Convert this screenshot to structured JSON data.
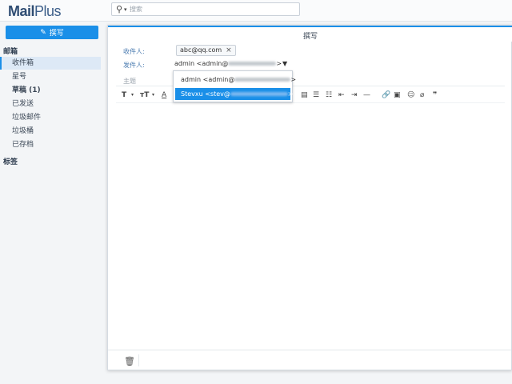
{
  "app": {
    "logo_main": "Mail",
    "logo_plus": "Plus"
  },
  "search": {
    "placeholder": "搜索",
    "search_glyph": "⚲",
    "caret": "▾"
  },
  "sidebar": {
    "compose_label": "撰写",
    "mailbox_title": "邮箱",
    "items": [
      {
        "label": "收件箱"
      },
      {
        "label": "星号"
      },
      {
        "label": "草稿 (1)"
      },
      {
        "label": "已发送"
      },
      {
        "label": "垃圾邮件"
      },
      {
        "label": "垃圾桶"
      },
      {
        "label": "已存档"
      }
    ],
    "labels_title": "标签"
  },
  "compose": {
    "window_title": "撰写",
    "to_label": "收件人:",
    "to_chip": "abc@qq.com",
    "from_label": "发件人:",
    "from_value_prefix": "admin <admin@",
    "from_value_suffix": ">",
    "subject_label": "主题",
    "dropdown": [
      {
        "prefix": "admin <admin@",
        "suffix": ">"
      },
      {
        "prefix": "Stevxu <stev@",
        "suffix": ">"
      }
    ]
  },
  "colors": {
    "accent": "#1a8fe8",
    "selection_bg": "#dde9f6",
    "logo": "#2f4d73"
  }
}
